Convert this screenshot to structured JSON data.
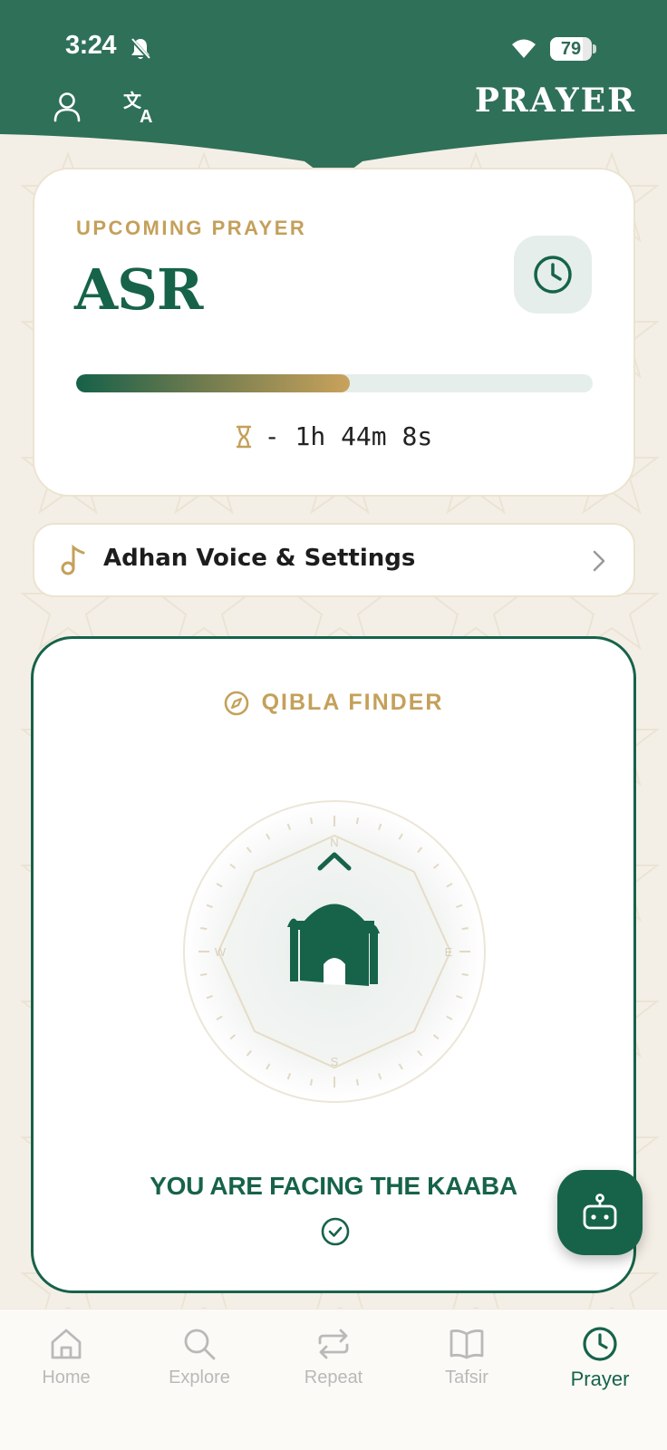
{
  "status_bar": {
    "time": "3:24",
    "battery": "79",
    "battery_level": 0.79
  },
  "header": {
    "title": "PRAYER",
    "profile_icon": "person-icon",
    "translate_icon": "translate-icon",
    "bg_color": "#2f7059"
  },
  "upcoming": {
    "label": "UPCOMING PRAYER",
    "prayer": "ASR",
    "progress": 0.53,
    "countdown": "- 1h 44m 8s",
    "clock_icon": "clock-icon",
    "hourglass_icon": "hourglass-icon"
  },
  "adhan": {
    "label": "Adhan Voice & Settings",
    "icon": "music-note-icon"
  },
  "qibla": {
    "title": "QIBLA FINDER",
    "directions": {
      "n": "N",
      "e": "E",
      "s": "S",
      "w": "W"
    },
    "status": "YOU ARE FACING THE KAABA",
    "title_icon": "compass-icon",
    "center_icon": "mosque-icon"
  },
  "fab": {
    "icon": "robot-icon"
  },
  "nav": {
    "items": [
      {
        "label": "Home",
        "icon": "home-icon"
      },
      {
        "label": "Explore",
        "icon": "search-icon"
      },
      {
        "label": "Repeat",
        "icon": "repeat-icon"
      },
      {
        "label": "Tafsir",
        "icon": "book-icon"
      },
      {
        "label": "Prayer",
        "icon": "clock-icon"
      }
    ],
    "active": "Prayer"
  },
  "colors": {
    "primary": "#16634a",
    "gold": "#c4a05a",
    "background": "#f4efe6",
    "inactive": "#b9b9b9"
  }
}
